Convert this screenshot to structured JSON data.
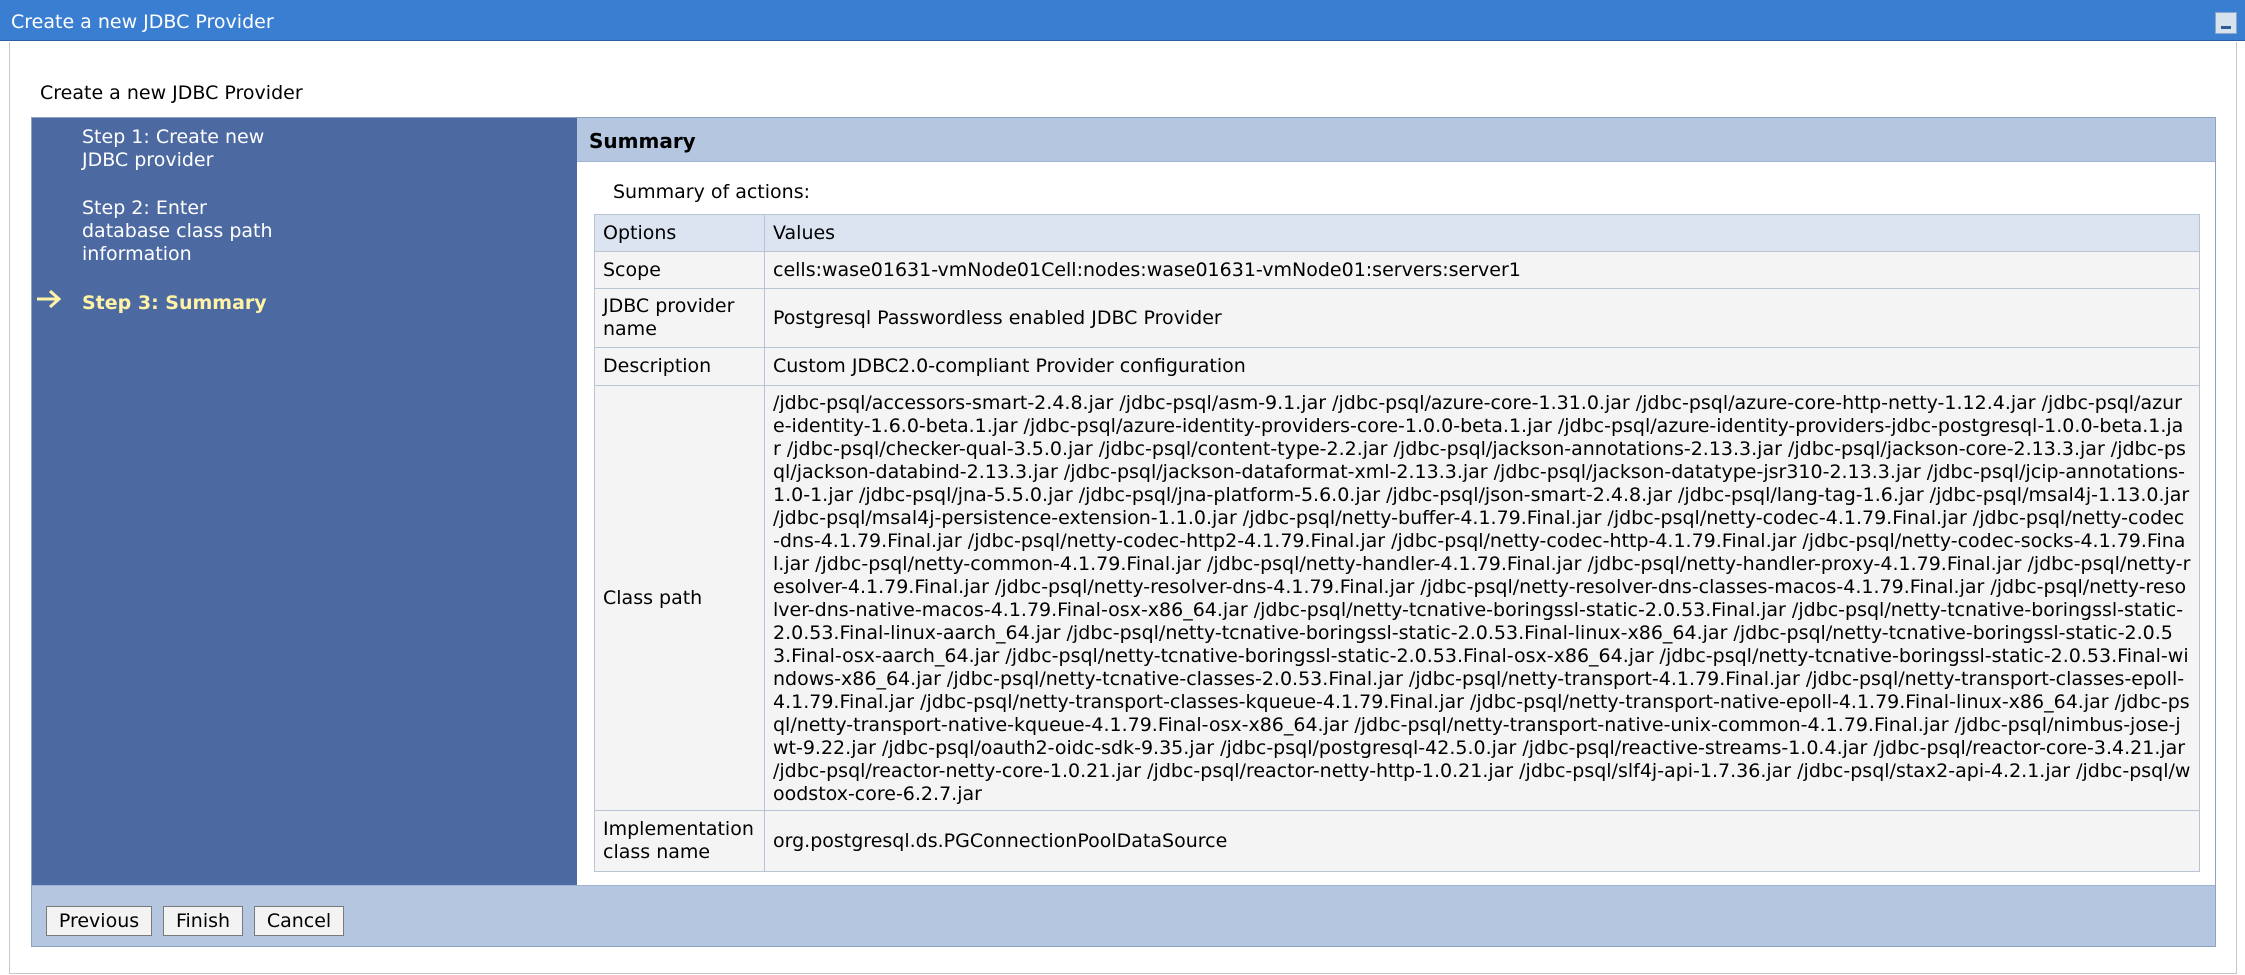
{
  "window": {
    "title": "Create a new JDBC Provider"
  },
  "page": {
    "heading": "Create a new JDBC Provider"
  },
  "steps": [
    {
      "label_lines": [
        "Step 1: Create new",
        "JDBC provider"
      ],
      "active": false
    },
    {
      "label_lines": [
        "Step 2: Enter",
        "database class path",
        "information"
      ],
      "active": false
    },
    {
      "label_lines": [
        "Step 3: Summary"
      ],
      "active": true
    }
  ],
  "summary": {
    "header": "Summary",
    "actions_label": "Summary of actions:",
    "columns": [
      "Options",
      "Values"
    ],
    "rows": [
      {
        "option": "Scope",
        "value": "cells:wase01631-vmNode01Cell:nodes:wase01631-vmNode01:servers:server1"
      },
      {
        "option": "JDBC provider name",
        "value": "Postgresql Passwordless enabled JDBC Provider"
      },
      {
        "option": "Description",
        "value": "Custom JDBC2.0-compliant Provider configuration"
      },
      {
        "option": "Class path",
        "value": "/jdbc-psql/accessors-smart-2.4.8.jar /jdbc-psql/asm-9.1.jar /jdbc-psql/azure-core-1.31.0.jar /jdbc-psql/azure-core-http-netty-1.12.4.jar /jdbc-psql/azure-identity-1.6.0-beta.1.jar /jdbc-psql/azure-identity-providers-core-1.0.0-beta.1.jar /jdbc-psql/azure-identity-providers-jdbc-postgresql-1.0.0-beta.1.jar /jdbc-psql/checker-qual-3.5.0.jar /jdbc-psql/content-type-2.2.jar /jdbc-psql/jackson-annotations-2.13.3.jar /jdbc-psql/jackson-core-2.13.3.jar /jdbc-psql/jackson-databind-2.13.3.jar /jdbc-psql/jackson-dataformat-xml-2.13.3.jar /jdbc-psql/jackson-datatype-jsr310-2.13.3.jar /jdbc-psql/jcip-annotations-1.0-1.jar /jdbc-psql/jna-5.5.0.jar /jdbc-psql/jna-platform-5.6.0.jar /jdbc-psql/json-smart-2.4.8.jar /jdbc-psql/lang-tag-1.6.jar /jdbc-psql/msal4j-1.13.0.jar /jdbc-psql/msal4j-persistence-extension-1.1.0.jar /jdbc-psql/netty-buffer-4.1.79.Final.jar /jdbc-psql/netty-codec-4.1.79.Final.jar /jdbc-psql/netty-codec-dns-4.1.79.Final.jar /jdbc-psql/netty-codec-http2-4.1.79.Final.jar /jdbc-psql/netty-codec-http-4.1.79.Final.jar /jdbc-psql/netty-codec-socks-4.1.79.Final.jar /jdbc-psql/netty-common-4.1.79.Final.jar /jdbc-psql/netty-handler-4.1.79.Final.jar /jdbc-psql/netty-handler-proxy-4.1.79.Final.jar /jdbc-psql/netty-resolver-4.1.79.Final.jar /jdbc-psql/netty-resolver-dns-4.1.79.Final.jar /jdbc-psql/netty-resolver-dns-classes-macos-4.1.79.Final.jar /jdbc-psql/netty-resolver-dns-native-macos-4.1.79.Final-osx-x86_64.jar /jdbc-psql/netty-tcnative-boringssl-static-2.0.53.Final.jar /jdbc-psql/netty-tcnative-boringssl-static-2.0.53.Final-linux-aarch_64.jar /jdbc-psql/netty-tcnative-boringssl-static-2.0.53.Final-linux-x86_64.jar /jdbc-psql/netty-tcnative-boringssl-static-2.0.53.Final-osx-aarch_64.jar /jdbc-psql/netty-tcnative-boringssl-static-2.0.53.Final-osx-x86_64.jar /jdbc-psql/netty-tcnative-boringssl-static-2.0.53.Final-windows-x86_64.jar /jdbc-psql/netty-tcnative-classes-2.0.53.Final.jar /jdbc-psql/netty-transport-4.1.79.Final.jar /jdbc-psql/netty-transport-classes-epoll-4.1.79.Final.jar /jdbc-psql/netty-transport-classes-kqueue-4.1.79.Final.jar /jdbc-psql/netty-transport-native-epoll-4.1.79.Final-linux-x86_64.jar /jdbc-psql/netty-transport-native-kqueue-4.1.79.Final-osx-x86_64.jar /jdbc-psql/netty-transport-native-unix-common-4.1.79.Final.jar /jdbc-psql/nimbus-jose-jwt-9.22.jar /jdbc-psql/oauth2-oidc-sdk-9.35.jar /jdbc-psql/postgresql-42.5.0.jar /jdbc-psql/reactive-streams-1.0.4.jar /jdbc-psql/reactor-core-3.4.21.jar /jdbc-psql/reactor-netty-core-1.0.21.jar /jdbc-psql/reactor-netty-http-1.0.21.jar /jdbc-psql/slf4j-api-1.7.36.jar /jdbc-psql/stax2-api-4.2.1.jar /jdbc-psql/woodstox-core-6.2.7.jar"
      },
      {
        "option": "Implementation class name",
        "value": "org.postgresql.ds.PGConnectionPoolDataSource"
      }
    ]
  },
  "buttons": {
    "previous": "Previous",
    "finish": "Finish",
    "cancel": "Cancel"
  },
  "colors": {
    "titlebar": "#3a7ed2",
    "steps_pane": "#4c6aa1",
    "active_step": "#fff3a6",
    "header_band": "#b4c6e0"
  },
  "icons": {
    "minimize": "minimize-icon",
    "current_step": "arrow-right-icon"
  }
}
